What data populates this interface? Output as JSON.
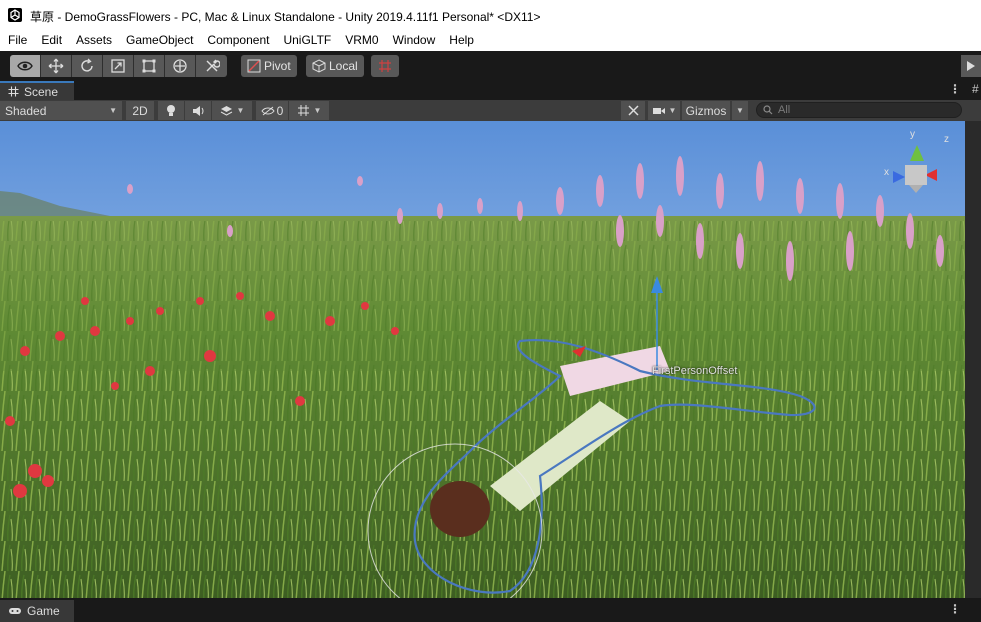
{
  "window": {
    "title": "草原 - DemoGrassFlowers - PC, Mac & Linux Standalone - Unity 2019.4.11f1 Personal* <DX11>"
  },
  "menu": {
    "items": [
      "File",
      "Edit",
      "Assets",
      "GameObject",
      "Component",
      "UniGLTF",
      "VRM0",
      "Window",
      "Help"
    ]
  },
  "toolbar": {
    "pivot_label": "Pivot",
    "local_label": "Local",
    "tools": [
      "view-tool-icon",
      "move-tool-icon",
      "rotate-tool-icon",
      "scale-tool-icon",
      "rect-tool-icon",
      "transform-tool-icon",
      "custom-tools-icon"
    ]
  },
  "scene_tab": {
    "label": "Scene"
  },
  "scene_toolbar": {
    "draw_mode": "Shaded",
    "mode_2d": "2D",
    "hidden_count": "0",
    "gizmos_label": "Gizmos",
    "search_placeholder": "All"
  },
  "viewport": {
    "object_label": "FirstPersonOffset",
    "gizmo_axis_y": "y",
    "gizmo_axis_x": "x",
    "gizmo_axis_z": "z"
  },
  "game_tab": {
    "label": "Game"
  },
  "colors": {
    "accent_tab": "#3a79bb",
    "toolbar_bg": "#191919",
    "button_bg": "#585858",
    "active_button_bg": "#a8a8a8",
    "outline_selection": "#4a78c0"
  }
}
